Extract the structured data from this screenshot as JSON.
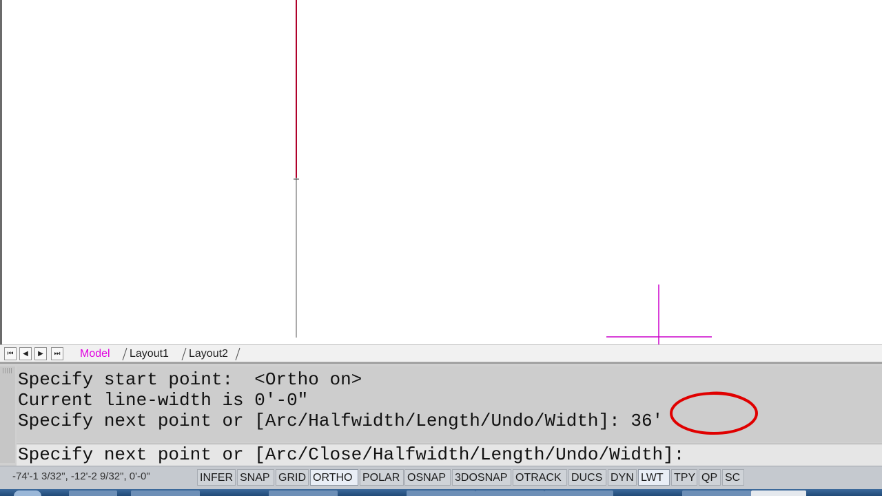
{
  "layout_tabs": {
    "nav_first": "⏮",
    "nav_prev": "◀",
    "nav_next": "▶",
    "nav_last": "⏭",
    "items": [
      {
        "label": "Model",
        "active": true
      },
      {
        "label": "Layout1",
        "active": false
      },
      {
        "label": "Layout2",
        "active": false
      }
    ]
  },
  "command_history": {
    "lines": [
      "Specify start point:  <Ortho on>",
      "Current line-width is 0'-0\"",
      "Specify next point or [Arc/Halfwidth/Length/Undo/Width]: 36'"
    ]
  },
  "command_line": {
    "prompt": "Specify next point or [Arc/Close/Halfwidth/Length/Undo/Width]:"
  },
  "status_bar": {
    "coordinates": "-74'-1 3/32\", -12'-2 9/32\", 0'-0\"",
    "toggles": [
      {
        "label": "INFER",
        "on": false
      },
      {
        "label": "SNAP",
        "on": false
      },
      {
        "label": "GRID",
        "on": false
      },
      {
        "label": "ORTHO",
        "on": true
      },
      {
        "label": "POLAR",
        "on": false
      },
      {
        "label": "OSNAP",
        "on": false
      },
      {
        "label": "3DOSNAP",
        "on": false
      },
      {
        "label": "OTRACK",
        "on": false
      },
      {
        "label": "DUCS",
        "on": false
      },
      {
        "label": "DYN",
        "on": false
      },
      {
        "label": "LWT",
        "on": true
      },
      {
        "label": "TPY",
        "on": false
      },
      {
        "label": "QP",
        "on": false
      },
      {
        "label": "SC",
        "on": false
      }
    ]
  },
  "colors": {
    "polyline": "#b0002a",
    "crosshair": "#cc00cc",
    "annotation": "#e00000",
    "active_tab": "#e000e0"
  }
}
